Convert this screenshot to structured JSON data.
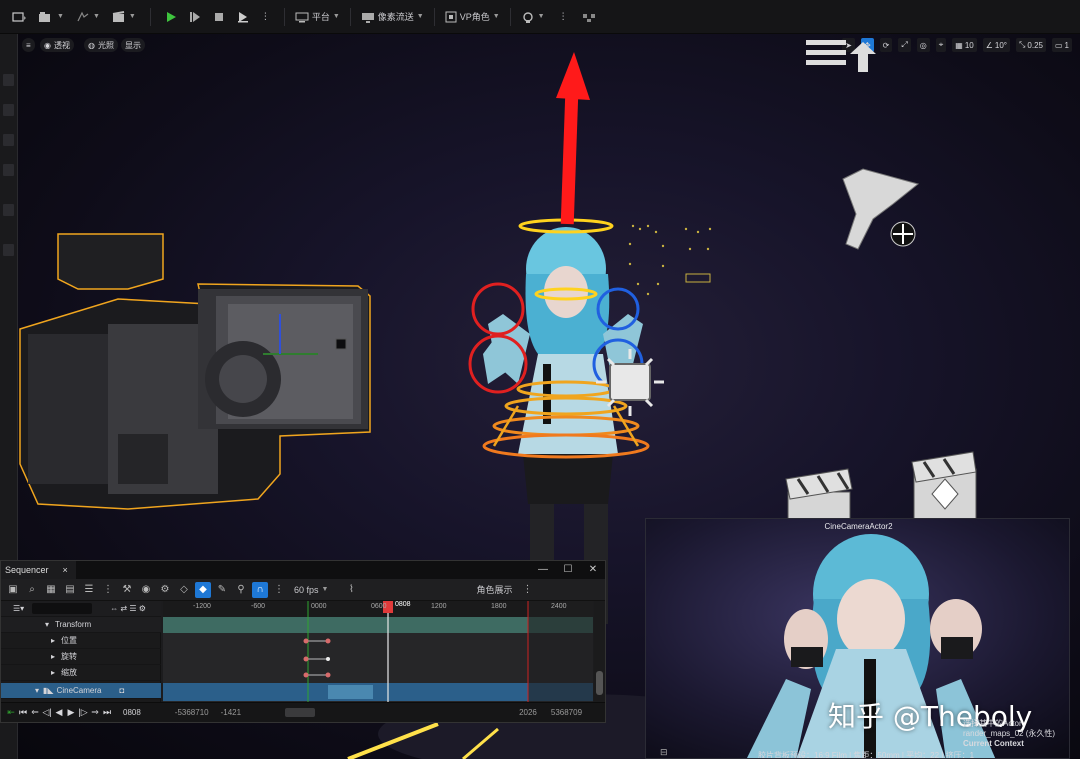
{
  "toolbar": {
    "platform_label": "平台",
    "pixel_streaming_label": "像素流送",
    "vp_role_label": "VP角色"
  },
  "viewport": {
    "perspective_label": "透视",
    "lit_label": "光照",
    "show_label": "显示",
    "grid_snap_value": "10",
    "rotation_snap_value": "10°",
    "scale_snap_value": "0.25",
    "camera_speed_value": "1"
  },
  "sequencer": {
    "tab_label": "Sequencer",
    "close_glyph": "×",
    "fps_label": "60 fps",
    "role_display_label": "角色展示",
    "current_frame_badge": "0808",
    "ruler_ticks": [
      "-1200",
      "-600",
      "0000",
      "0600",
      "1200",
      "1800",
      "2400"
    ],
    "tracks": {
      "transform": "Transform",
      "location": "位置",
      "rotation": "旋转",
      "scale": "缩放",
      "camera": "CineCamera"
    },
    "footer": {
      "current_frame": "0808",
      "range_start": "-5368710",
      "view_start": "-1421",
      "view_end": "2026",
      "range_end": "5368709"
    }
  },
  "preview": {
    "title": "CineCameraActor2",
    "watermark": "知乎 @Theboly",
    "selected_line": "选择其中的Actor",
    "map_line": "rander_maps_02 (永久性)",
    "context_line": "Current Context",
    "info_line": "胶片背板预设：16:9 Film | 焦距：50mm | 平均：22 | 挤压：1"
  },
  "colors": {
    "accent_blue": "#1e78d6",
    "gizmo_red": "#ff1a1a",
    "selection_orange": "#f0a51e",
    "ring_yellow": "#ffd21e",
    "play_green": "#3ec43e"
  }
}
